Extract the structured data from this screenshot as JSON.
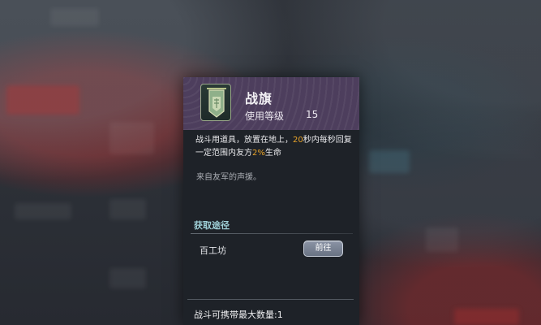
{
  "item": {
    "name": "战旗",
    "icon": "war-banner-icon",
    "level_label": "使用等级",
    "level_value": "15"
  },
  "description": {
    "text_1": "战斗用道具，放置在地上，",
    "highlight_seconds": "20",
    "text_2": "秒内每秒回复一定范围内友方",
    "highlight_percent": "2%",
    "text_3": "生命",
    "flavor": "来自友军的声援。"
  },
  "source": {
    "title": "获取途径",
    "name": "百工坊",
    "go_button_label": "前往"
  },
  "carry_limit": "战斗可携带最大数量:1",
  "colors": {
    "header_bg": "#4d3e5d",
    "panel_bg": "#1e2228",
    "highlight": "#e8a42a",
    "source_title": "#9ecfd6"
  }
}
